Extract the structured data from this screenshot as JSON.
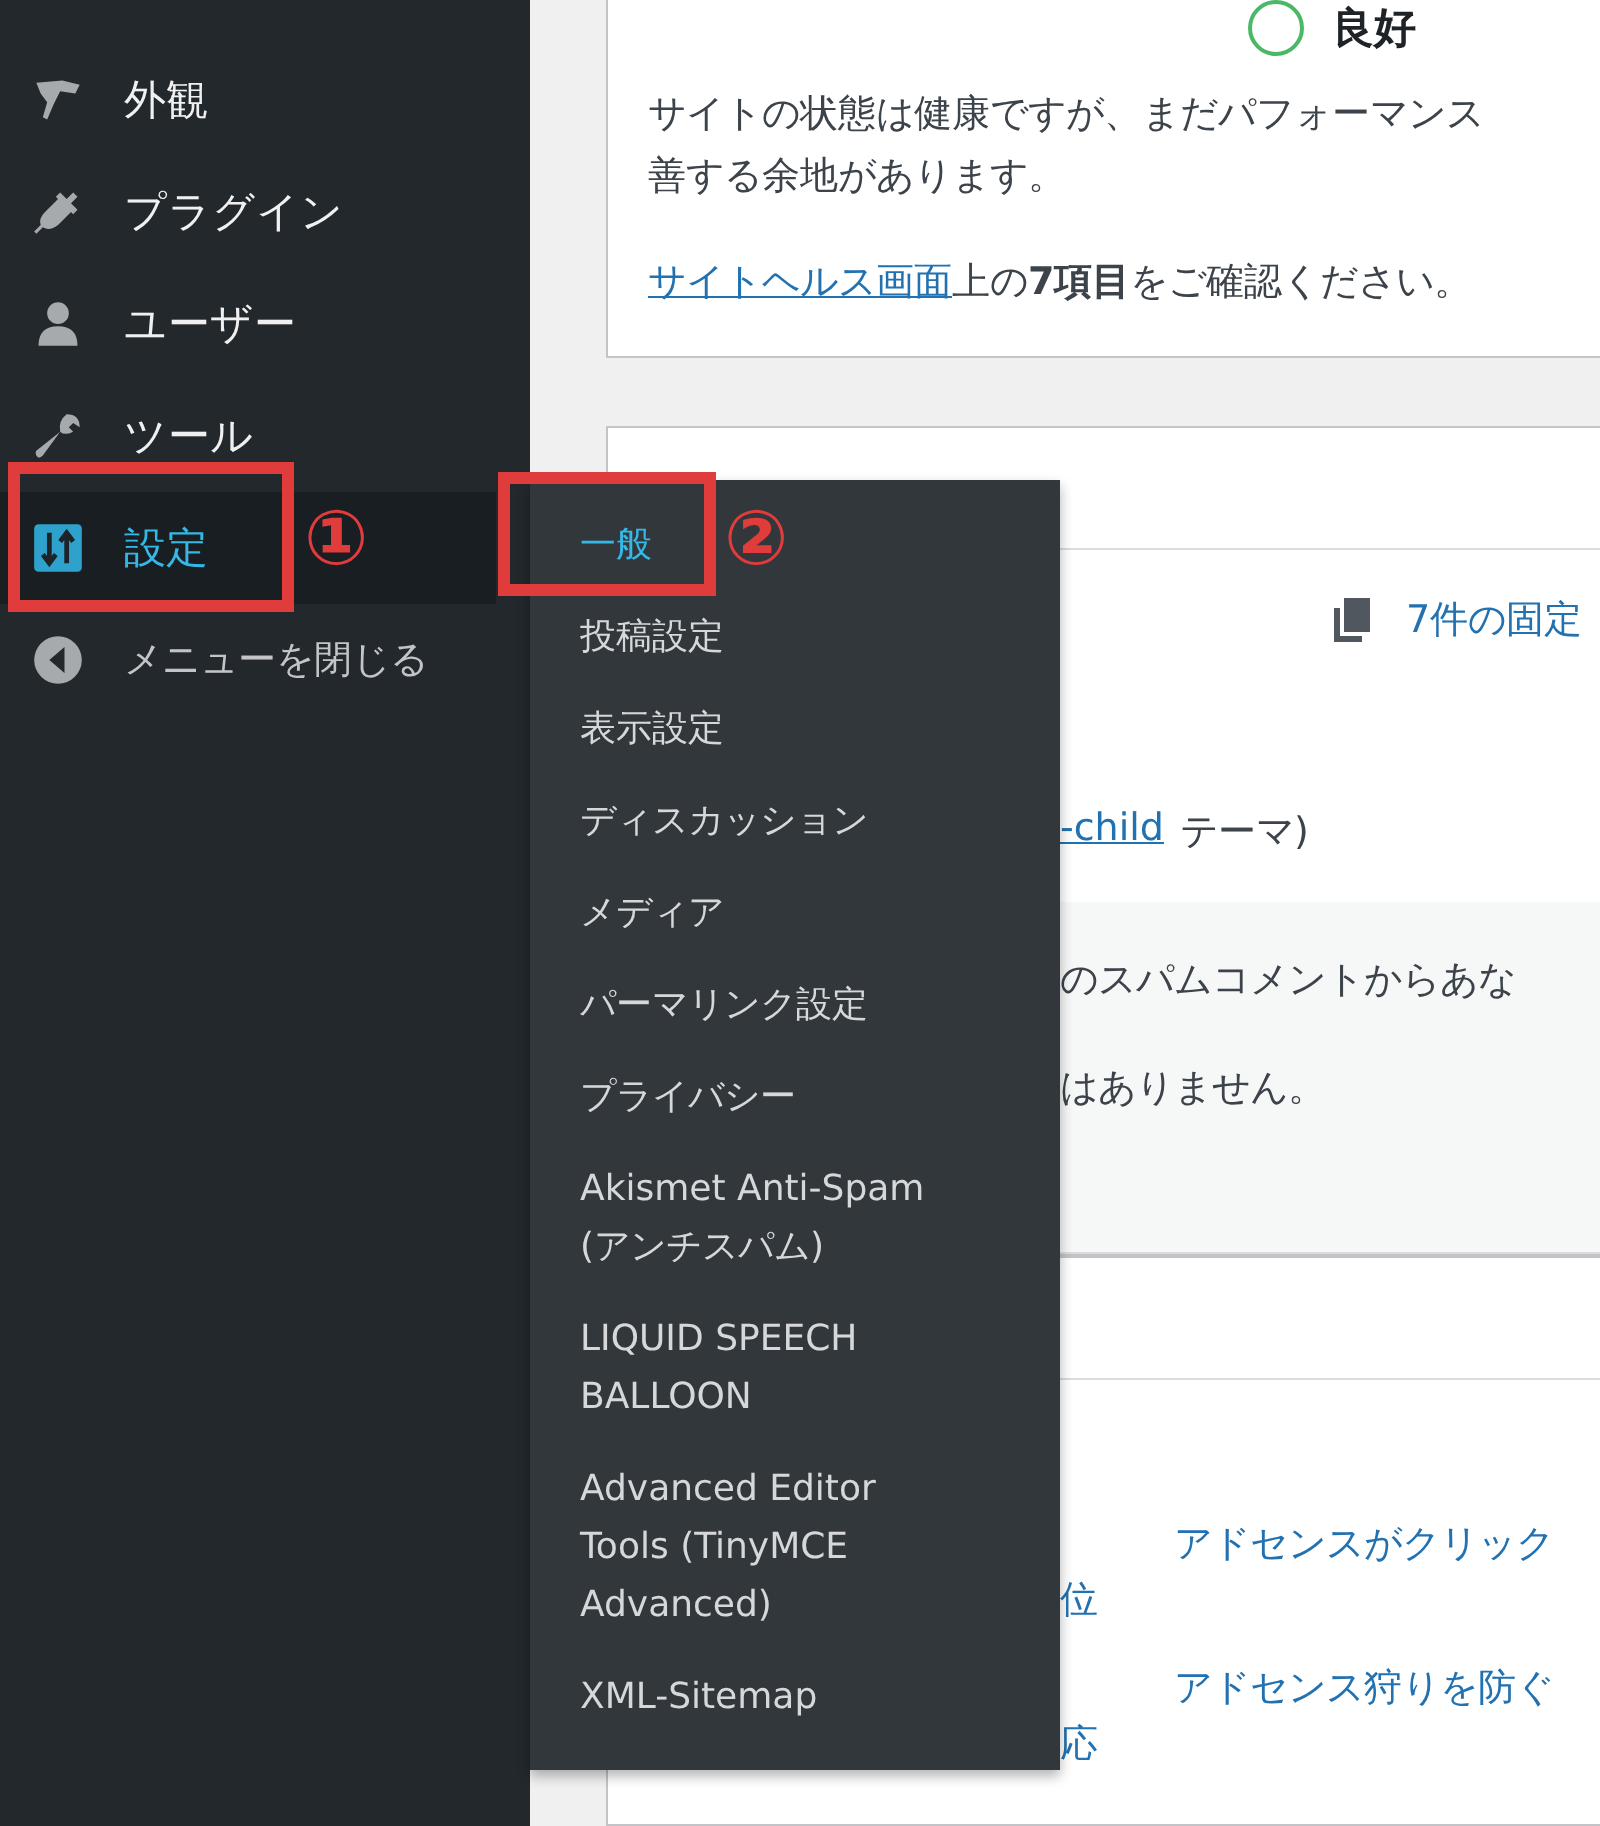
{
  "sidebar": {
    "items": [
      {
        "label": "外観",
        "selected": false
      },
      {
        "label": "プラグイン",
        "selected": false
      },
      {
        "label": "ユーザー",
        "selected": false
      },
      {
        "label": "ツール",
        "selected": false
      },
      {
        "label": "設定",
        "selected": true
      },
      {
        "label": "メニューを閉じる",
        "selected": false
      }
    ]
  },
  "annotations": [
    {
      "label": "①"
    },
    {
      "label": "②"
    }
  ],
  "flyout": {
    "items": [
      {
        "label": "一般",
        "selected": true
      },
      {
        "label": "投稿設定",
        "selected": false
      },
      {
        "label": "表示設定",
        "selected": false
      },
      {
        "label": "ディスカッション",
        "selected": false
      },
      {
        "label": "メディア",
        "selected": false
      },
      {
        "label": "パーマリンク設定",
        "selected": false
      },
      {
        "label": "プライバシー",
        "selected": false
      },
      {
        "label": "Akismet Anti-Spam",
        "label_continued": [
          "(アンチスパム)"
        ],
        "selected": false
      },
      {
        "label": "LIQUID SPEECH",
        "label_continued": [
          "BALLOON"
        ],
        "selected": false
      },
      {
        "label": "Advanced Editor",
        "label_continued": [
          "Tools (TinyMCE",
          "Advanced)"
        ],
        "selected": false
      },
      {
        "label": "XML-Sitemap",
        "selected": false
      }
    ]
  },
  "health_card": {
    "status": "良好",
    "message_lines": [
      "サイトの状態は健康ですが、まだパフォーマンス",
      "善する余地があります。"
    ],
    "link": "サイトヘルス画面",
    "after_link": "上の**7項目**をご確認ください。"
  },
  "glance_card": {
    "pages_link": "7件の固定",
    "theme_link": "-child",
    "theme_after": "テーマ)",
    "notes": [
      "のスパムコメントからあな",
      "はありません。"
    ]
  },
  "news_card": {
    "links": [
      "アドセンスがクリック",
      "位",
      "アドセンス狩りを防ぐ",
      "応"
    ]
  }
}
